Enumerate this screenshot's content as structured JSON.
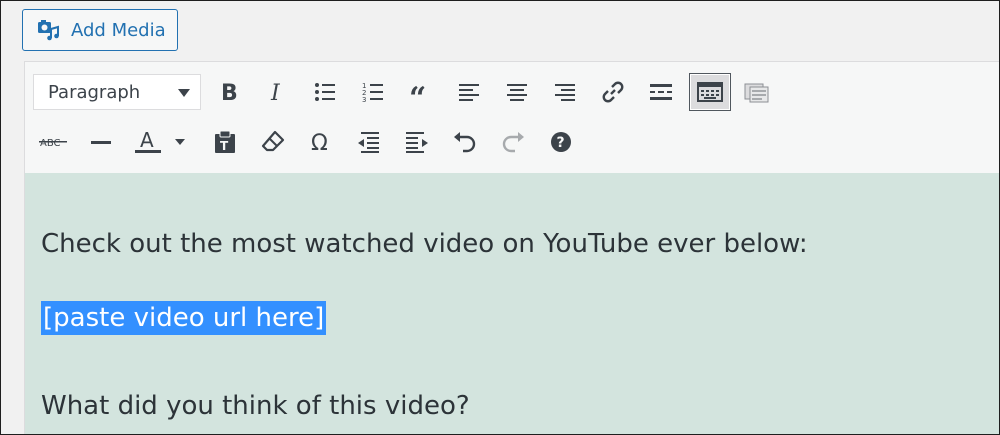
{
  "add_media": {
    "label": "Add Media",
    "icon": "add-media-icon"
  },
  "toolbar": {
    "format": {
      "selected": "Paragraph"
    },
    "row1": [
      {
        "name": "bold-icon",
        "interactable": true
      },
      {
        "name": "italic-icon",
        "interactable": true
      },
      {
        "name": "bullet-list-icon",
        "interactable": true
      },
      {
        "name": "numbered-list-icon",
        "interactable": true
      },
      {
        "name": "blockquote-icon",
        "interactable": true
      },
      {
        "name": "align-left-icon",
        "interactable": true
      },
      {
        "name": "align-center-icon",
        "interactable": true
      },
      {
        "name": "align-right-icon",
        "interactable": true
      },
      {
        "name": "link-icon",
        "interactable": true
      },
      {
        "name": "read-more-icon",
        "interactable": true
      },
      {
        "name": "toolbar-toggle-icon",
        "interactable": true,
        "active": true
      },
      {
        "name": "fullscreen-icon",
        "interactable": true
      }
    ],
    "row2": [
      {
        "name": "strikethrough-icon",
        "interactable": true
      },
      {
        "name": "horizontal-line-icon",
        "interactable": true
      },
      {
        "name": "text-color-icon",
        "interactable": true
      },
      {
        "name": "paste-as-text-icon",
        "interactable": true
      },
      {
        "name": "clear-formatting-icon",
        "interactable": true
      },
      {
        "name": "special-character-icon",
        "interactable": true
      },
      {
        "name": "outdent-icon",
        "interactable": true
      },
      {
        "name": "indent-icon",
        "interactable": true
      },
      {
        "name": "undo-icon",
        "interactable": true
      },
      {
        "name": "redo-icon",
        "interactable": false
      },
      {
        "name": "help-icon",
        "interactable": true
      }
    ],
    "text_color_letter": "A",
    "strike_label": "ABC",
    "omega": "Ω"
  },
  "content": {
    "paragraphs": [
      "Check out the most watched video on YouTube ever below:",
      "[paste video url here]",
      "What did you think of this video?"
    ]
  },
  "colors": {
    "accent": "#2271b1",
    "selection": "#3390ff",
    "content_bg": "#d3e4de"
  }
}
